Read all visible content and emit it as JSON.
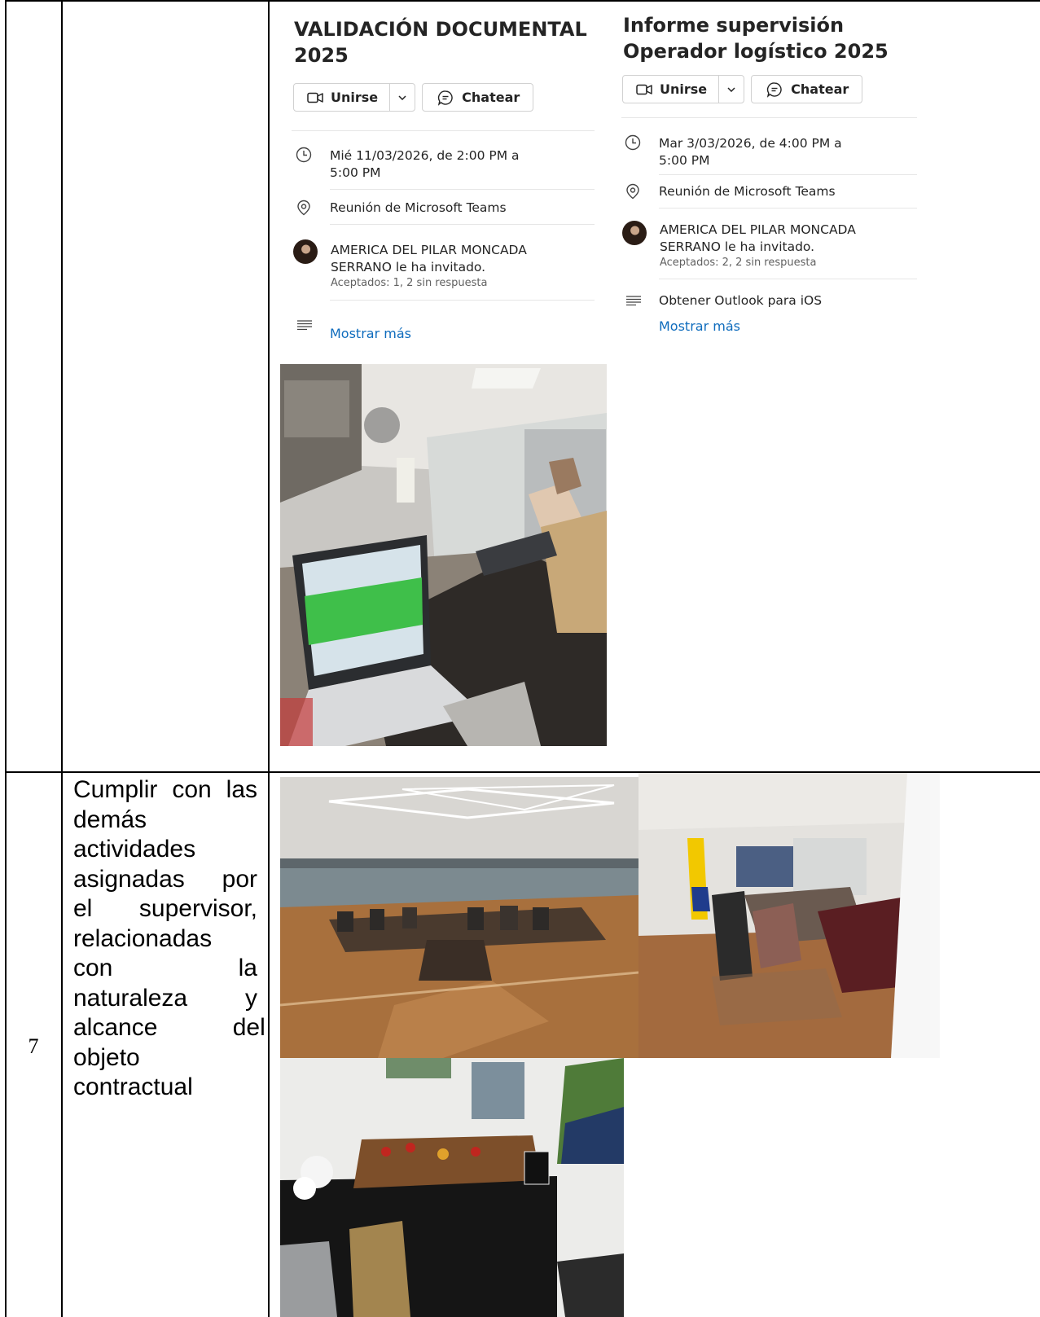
{
  "row": {
    "number": "7",
    "description_lines": [
      "Cumplir con las",
      "demás",
      "actividades",
      "asignadas por",
      "el supervisor,",
      "relacionadas",
      "con la",
      "naturaleza y",
      "alcance del",
      "objeto",
      "contractual"
    ]
  },
  "cards": [
    {
      "title_line1": "VALIDACIÓN DOCUMENTAL",
      "title_line2": "2025",
      "join_label": "Unirse",
      "chat_label": "Chatear",
      "date_line1": "Mié 11/03/2026, de 2:00 PM a",
      "date_line2": "5:00 PM",
      "location": "Reunión de Microsoft Teams",
      "organizer_line1": "AMERICA DEL PILAR MONCADA",
      "organizer_line2": "SERRANO le ha invitado.",
      "responses": "Aceptados: 1, 2 sin respuesta",
      "show_more": "Mostrar más"
    },
    {
      "title_line1": "Informe supervisión",
      "title_line2": "Operador logístico 2025",
      "join_label": "Unirse",
      "chat_label": "Chatear",
      "date_line1": "Mar 3/03/2026, de 4:00 PM a",
      "date_line2": "5:00 PM",
      "location": "Reunión de Microsoft Teams",
      "organizer_line1": "AMERICA DEL PILAR MONCADA",
      "organizer_line2": "SERRANO le ha invitado.",
      "responses": "Aceptados: 2, 2 sin respuesta",
      "note": "Obtener Outlook para iOS",
      "show_more": "Mostrar más"
    }
  ],
  "colors": {
    "link": "#0f6cbd",
    "text": "#242424",
    "border": "#d1d1d1",
    "grid": "#000000"
  }
}
